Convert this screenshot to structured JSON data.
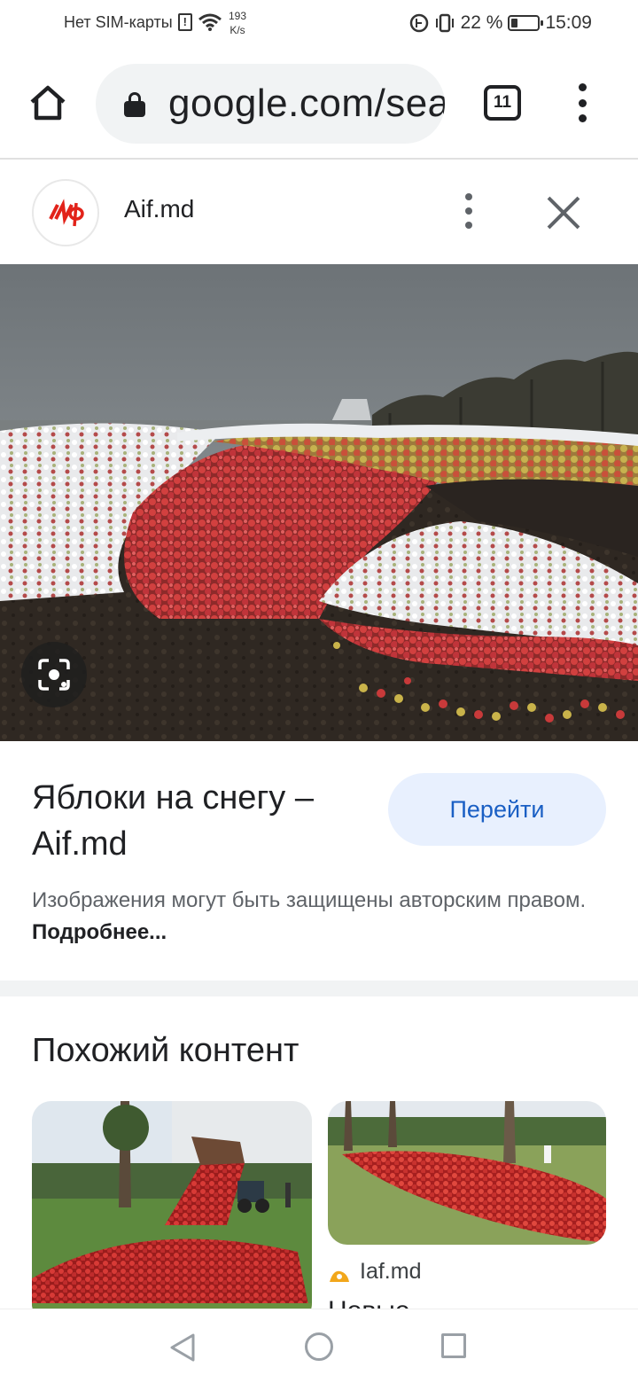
{
  "status_bar": {
    "sim_text": "Нет SIM-карты",
    "speed_value": "193",
    "speed_unit": "K/s",
    "battery_percent": "22 %",
    "battery_level": 0.22,
    "time": "15:09"
  },
  "toolbar": {
    "url": "google.com/search",
    "tab_count": "11"
  },
  "source": {
    "name": "Aif.md",
    "favicon_text": "иф",
    "brand_color": "#e2231a"
  },
  "result": {
    "title": "Яблоки на снегу – Aif.md",
    "visit_label": "Перейти",
    "copyright_notice": "Изображения могут быть защищены авторским правом.",
    "more_link": "Подробнее..."
  },
  "similar": {
    "heading": "Похожий контент",
    "items": [
      {
        "source": "",
        "title": ""
      },
      {
        "source": "Iaf.md",
        "title": "Новые"
      }
    ]
  },
  "colors": {
    "accent": "#1a5fc4",
    "button_bg": "#e8f0fe",
    "divider": "#f1f3f4"
  }
}
